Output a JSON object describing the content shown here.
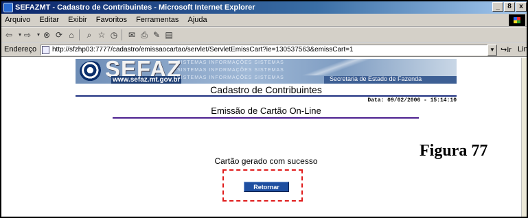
{
  "window": {
    "title": "SEFAZMT - Cadastro de Contribuintes - Microsoft Internet Explorer",
    "controls": [
      "_",
      "8",
      "x"
    ]
  },
  "menu": [
    "Arquivo",
    "Editar",
    "Exibir",
    "Favoritos",
    "Ferramentas",
    "Ajuda"
  ],
  "address": {
    "label": "Endereço",
    "url": "http://sfzhp03:7777/cadastro/emissaocartao/servlet/ServletEmissCart?ie=130537563&emissCart=1",
    "go_label": "Ir",
    "links_label": "Links"
  },
  "banner": {
    "logo": "SEFAZ",
    "url": "www.sefaz.mt.gov.br",
    "rows": [
      "SISTEMAS  INFORMAÇÕES  SISTEMAS",
      "SISTEMAS  INFORMAÇÕES  SISTEMAS",
      "SISTEMAS  INFORMAÇÕES  SISTEMAS"
    ],
    "secretaria": "Secretaria de Estado de Fazenda"
  },
  "page": {
    "heading": "Cadastro de Contribuintes",
    "date": "Data: 09/02/2006 - 15:14:10",
    "section_title": "Emissão de Cartão On-Line",
    "message": "Cartão gerado com sucesso",
    "button": "Retornar"
  },
  "caption": "Figura 77",
  "colors": {
    "titlebar": "#0a246a",
    "rule": "#1d2f80",
    "highlight": "#e01b1b",
    "button": "#1f4fa0"
  }
}
